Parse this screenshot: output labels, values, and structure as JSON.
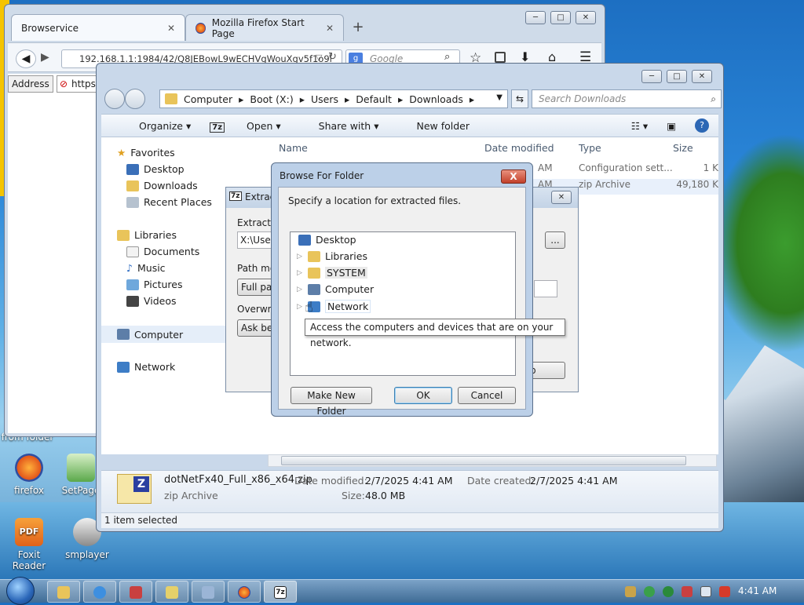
{
  "firefox": {
    "tab1_title": "Browservice",
    "tab2_title": "Mozilla Firefox Start Page",
    "url": "192.168.1.1:1984/42/Q8JEBowL9wECHVgWouXgv5f1o9l",
    "search_placeholder": "Google",
    "address_label": "Address",
    "address_value": "https:"
  },
  "explorer": {
    "breadcrumb": [
      "Computer",
      "Boot (X:)",
      "Users",
      "Default",
      "Downloads"
    ],
    "search_placeholder": "Search Downloads",
    "commands": {
      "organize": "Organize",
      "open": "Open",
      "share_with": "Share with",
      "new_folder": "New folder"
    },
    "nav": {
      "favorites": "Favorites",
      "desktop": "Desktop",
      "downloads": "Downloads",
      "recent_places": "Recent Places",
      "libraries": "Libraries",
      "documents": "Documents",
      "music": "Music",
      "pictures": "Pictures",
      "videos": "Videos",
      "computer": "Computer",
      "network": "Network"
    },
    "columns": {
      "name": "Name",
      "date_modified": "Date modified",
      "type": "Type",
      "size": "Size"
    },
    "rows": [
      {
        "date": "AM",
        "type": "Configuration sett...",
        "size": "1 K"
      },
      {
        "date": "AM",
        "type": "zip Archive",
        "size": "49,180 K"
      }
    ],
    "details": {
      "filename": "dotNetFx40_Full_x86_x64.zip",
      "filetype": "zip Archive",
      "modified_label": "Date modified:",
      "modified_value": "2/7/2025 4:41 AM",
      "created_label": "Date created:",
      "created_value": "2/7/2025 4:41 AM",
      "size_label": "Size:",
      "size_value": "48.0 MB"
    },
    "status": "1 item selected"
  },
  "extract": {
    "title": "Extract",
    "extract_to_label": "Extract to",
    "path_value": "X:\\Users",
    "path_mode_label": "Path mod",
    "path_mode_value": "Full path",
    "overwrite_label": "Overwrite",
    "overwrite_value": "Ask befo",
    "browse_label": "...",
    "button_tail": "p"
  },
  "browse": {
    "title": "Browse For Folder",
    "instruction": "Specify a location for extracted files.",
    "tree": [
      "Desktop",
      "Libraries",
      "SYSTEM",
      "Computer",
      "Network"
    ],
    "tooltip": "Access the computers and devices that are on your network.",
    "make_new_folder": "Make New Folder",
    "ok": "OK",
    "cancel": "Cancel",
    "close": "X"
  },
  "desktop_icons": [
    "from folder",
    "firefox",
    "SetPage",
    "Foxit Reader",
    "smplayer"
  ],
  "taskbar": {
    "clock": "4:41 AM"
  }
}
